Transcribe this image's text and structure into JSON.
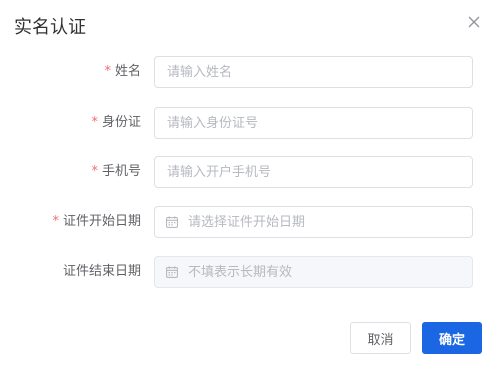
{
  "dialog": {
    "title": "实名认证",
    "close_icon": "close-icon"
  },
  "form": {
    "fields": [
      {
        "label": "姓名",
        "required": true,
        "placeholder": "请输入姓名",
        "value": ""
      },
      {
        "label": "身份证",
        "required": true,
        "placeholder": "请输入身份证号",
        "value": ""
      },
      {
        "label": "手机号",
        "required": true,
        "placeholder": "请输入开户手机号",
        "value": ""
      },
      {
        "label": "证件开始日期",
        "required": true,
        "placeholder": "请选择证件开始日期",
        "value": "",
        "icon": "calendar-icon"
      },
      {
        "label": "证件结束日期",
        "required": false,
        "placeholder": "不填表示长期有效",
        "value": "",
        "icon": "calendar-icon",
        "disabled": true
      }
    ],
    "required_mark": "*"
  },
  "footer": {
    "cancel_label": "取消",
    "confirm_label": "确定"
  },
  "colors": {
    "primary": "#1b67e3",
    "required": "#f56c6c",
    "border": "#dcdfe6",
    "disabled_bg": "#f5f7fa"
  }
}
